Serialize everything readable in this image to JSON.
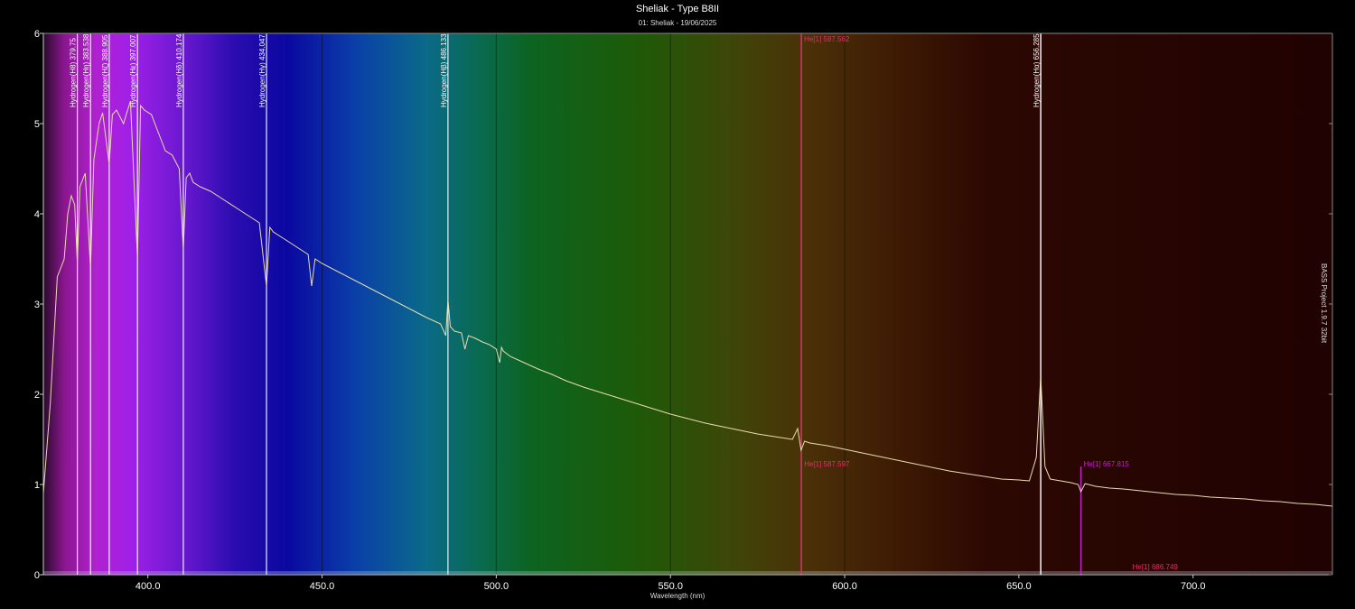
{
  "chart_data": {
    "type": "line",
    "title": "Sheliak - Type B8II",
    "subtitle": "01: Sheliak - 19/06/2025",
    "xlabel": "Wavelength (nm)",
    "credit": "BASS Project 1.9.7 32bit",
    "xlim": [
      370,
      740
    ],
    "ylim": [
      0,
      6
    ],
    "xticks": [
      400,
      450,
      500,
      550,
      600,
      650,
      700
    ],
    "xtick_labels": [
      "400.0",
      "450.0",
      "500.0",
      "550.0",
      "600.0",
      "650.0",
      "700.0"
    ],
    "yticks": [
      0,
      1,
      2,
      3,
      4,
      5,
      6
    ],
    "ytick_labels": [
      "0",
      "1",
      "2",
      "3",
      "4",
      "5",
      "6"
    ],
    "vgrid": [
      450,
      500,
      550,
      600
    ],
    "spectrum_colors": [
      {
        "nm": 370,
        "color": "#2a0a2a"
      },
      {
        "nm": 376,
        "color": "#8a1690"
      },
      {
        "nm": 385,
        "color": "#b021d0"
      },
      {
        "nm": 395,
        "color": "#a020e8"
      },
      {
        "nm": 410,
        "color": "#6a18d0"
      },
      {
        "nm": 425,
        "color": "#2a0cb0"
      },
      {
        "nm": 440,
        "color": "#0a08a0"
      },
      {
        "nm": 460,
        "color": "#0a40a8"
      },
      {
        "nm": 480,
        "color": "#0a6a88"
      },
      {
        "nm": 495,
        "color": "#0a6a50"
      },
      {
        "nm": 510,
        "color": "#0c6420"
      },
      {
        "nm": 540,
        "color": "#1e5a08"
      },
      {
        "nm": 570,
        "color": "#404408"
      },
      {
        "nm": 590,
        "color": "#4a3008"
      },
      {
        "nm": 615,
        "color": "#3e1a04"
      },
      {
        "nm": 640,
        "color": "#2c0802"
      },
      {
        "nm": 740,
        "color": "#200202"
      }
    ],
    "line_markers": [
      {
        "nm": 379.75,
        "label": "Hydrogen(H8) 379.75",
        "color": "#ffffff",
        "position": "top"
      },
      {
        "nm": 383.538,
        "label": "Hydrogen(Hη) 383.538",
        "color": "#ffffff",
        "position": "top"
      },
      {
        "nm": 388.905,
        "label": "Hydrogen(Hζ) 388.905",
        "color": "#ffffff",
        "position": "top"
      },
      {
        "nm": 397.007,
        "label": "Hydrogen(Hε) 397.007",
        "color": "#ffffff",
        "position": "top"
      },
      {
        "nm": 410.174,
        "label": "Hydrogen(Hδ) 410.174",
        "color": "#ffffff",
        "position": "top"
      },
      {
        "nm": 434.047,
        "label": "Hydrogen(Hγ) 434.047",
        "color": "#ffffff",
        "position": "top"
      },
      {
        "nm": 486.133,
        "label": "Hydrogen(Hβ) 486.133",
        "color": "#ffffff",
        "position": "top"
      },
      {
        "nm": 656.285,
        "label": "Hydrogen(Hα) 656.285",
        "color": "#ffffff",
        "position": "top"
      },
      {
        "nm": 587.562,
        "label": "He[1] 587.562",
        "color": "#e0306a",
        "position": "top-horizontal"
      },
      {
        "nm": 587.597,
        "label": "He[1] 587.597",
        "color": "#e0306a",
        "position": "mid-horizontal"
      },
      {
        "nm": 667.815,
        "label": "He[1] 667.815",
        "color": "#c020c8",
        "position": "mid-horizontal"
      },
      {
        "nm": 686.749,
        "label": "He[1] 686.749",
        "color": "#e0306a",
        "position": "bottom-horizontal"
      }
    ],
    "series": [
      {
        "color": "#e8dcb0",
        "x": [
          370,
          372,
          374,
          376,
          377,
          378,
          379,
          379.75,
          380.5,
          382,
          383.538,
          384.5,
          386,
          387,
          388.905,
          389.8,
          391,
          393,
          395,
          397.007,
          397.9,
          399,
          401,
          403,
          405,
          407,
          409,
          410.174,
          411,
          412,
          413,
          415,
          418,
          422,
          426,
          430,
          432,
          434.047,
          435,
          436,
          440,
          444,
          446,
          447,
          448,
          450,
          455,
          460,
          465,
          470,
          475,
          480,
          484,
          485.5,
          486.133,
          486.8,
          488,
          490,
          491,
          492,
          494,
          496,
          498,
          500,
          501,
          501.5,
          502,
          504,
          508,
          512,
          516,
          520,
          525,
          530,
          535,
          540,
          545,
          550,
          555,
          560,
          565,
          570,
          575,
          580,
          585,
          586.5,
          587.5,
          588.5,
          590,
          595,
          600,
          605,
          610,
          615,
          620,
          625,
          630,
          635,
          640,
          645,
          650,
          653,
          655,
          656.285,
          657.5,
          659,
          662,
          665,
          667,
          667.815,
          669,
          672,
          676,
          680,
          685,
          690,
          695,
          700,
          705,
          710,
          715,
          720,
          725,
          730,
          735,
          740
        ],
        "y": [
          0.9,
          1.9,
          3.3,
          3.5,
          4.0,
          4.2,
          4.1,
          3.45,
          4.3,
          4.45,
          3.4,
          4.6,
          5.0,
          5.12,
          4.55,
          5.1,
          5.15,
          5.0,
          5.25,
          3.5,
          5.2,
          5.15,
          5.1,
          4.9,
          4.7,
          4.65,
          4.5,
          3.6,
          4.4,
          4.45,
          4.35,
          4.3,
          4.25,
          4.15,
          4.05,
          3.95,
          3.9,
          3.2,
          3.85,
          3.8,
          3.7,
          3.6,
          3.55,
          3.2,
          3.5,
          3.45,
          3.35,
          3.25,
          3.15,
          3.05,
          2.95,
          2.85,
          2.78,
          2.65,
          3.05,
          2.75,
          2.7,
          2.68,
          2.5,
          2.65,
          2.62,
          2.58,
          2.55,
          2.5,
          2.35,
          2.52,
          2.48,
          2.42,
          2.35,
          2.28,
          2.22,
          2.15,
          2.08,
          2.02,
          1.96,
          1.9,
          1.84,
          1.78,
          1.73,
          1.68,
          1.64,
          1.6,
          1.56,
          1.53,
          1.5,
          1.62,
          1.38,
          1.48,
          1.46,
          1.43,
          1.39,
          1.35,
          1.31,
          1.27,
          1.23,
          1.19,
          1.15,
          1.12,
          1.09,
          1.06,
          1.05,
          1.04,
          1.3,
          2.2,
          1.2,
          1.06,
          1.04,
          1.02,
          1.0,
          0.92,
          1.01,
          0.98,
          0.96,
          0.95,
          0.93,
          0.91,
          0.89,
          0.88,
          0.86,
          0.85,
          0.84,
          0.82,
          0.81,
          0.79,
          0.78,
          0.76
        ]
      }
    ]
  }
}
